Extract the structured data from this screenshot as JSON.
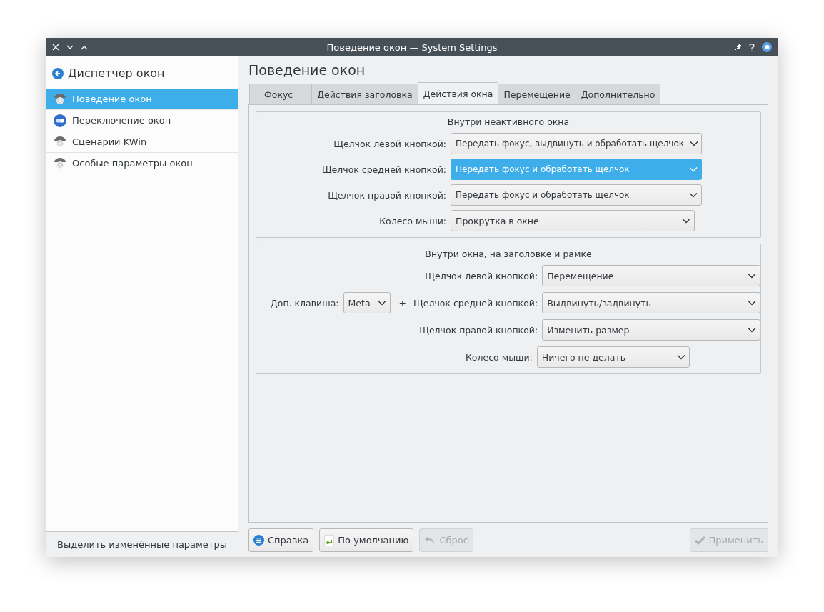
{
  "window": {
    "title": "Поведение окон — System Settings"
  },
  "sidebar": {
    "title": "Диспетчер окон",
    "items": [
      {
        "label": "Поведение окон",
        "selected": true,
        "kind": "gear"
      },
      {
        "label": "Переключение окон",
        "selected": false,
        "kind": "switch"
      },
      {
        "label": "Сценарии KWin",
        "selected": false,
        "kind": "gear"
      },
      {
        "label": "Особые параметры окон",
        "selected": false,
        "kind": "gear"
      }
    ],
    "footer": "Выделить изменённые параметры"
  },
  "page_title": "Поведение окон",
  "tabs": [
    {
      "label": "Фокус",
      "selected": false
    },
    {
      "label": "Действия заголовка",
      "selected": false
    },
    {
      "label": "Действия окна",
      "selected": true
    },
    {
      "label": "Перемещение",
      "selected": false
    },
    {
      "label": "Дополнительно",
      "selected": false
    }
  ],
  "inactive_group": {
    "title": "Внутри неактивного окна",
    "rows": [
      {
        "label": "Щелчок левой кнопкой:",
        "value": "Передать фокус, выдвинуть и обработать щелчок",
        "focused": false
      },
      {
        "label": "Щелчок средней кнопкой:",
        "value": "Передать фокус и обработать щелчок",
        "focused": true
      },
      {
        "label": "Щелчок правой кнопкой:",
        "value": "Передать фокус и обработать щелчок",
        "focused": false
      },
      {
        "label": "Колесо мыши:",
        "value": "Прокрутка в окне",
        "focused": false
      }
    ]
  },
  "active_group": {
    "title": "Внутри окна, на заголовке и рамке",
    "modifier_label": "Доп. клавиша:",
    "modifier_value": "Meta",
    "plus": "+",
    "rows": [
      {
        "label": "Щелчок левой кнопкой:",
        "value": "Перемещение",
        "focused": false
      },
      {
        "label": "Щелчок средней кнопкой:",
        "value": "Выдвинуть/задвинуть",
        "focused": false
      },
      {
        "label": "Щелчок правой кнопкой:",
        "value": "Изменить размер",
        "focused": false
      }
    ],
    "wheel": {
      "label": "Колесо мыши:",
      "value": "Ничего не делать",
      "focused": false
    }
  },
  "buttons": [
    {
      "label": "Справка",
      "kind": "help",
      "disabled": false
    },
    {
      "label": "По умолчанию",
      "kind": "defaults",
      "disabled": false
    },
    {
      "label": "Сброс",
      "kind": "reset",
      "disabled": true
    }
  ],
  "apply_button": {
    "label": "Применить",
    "disabled": true
  }
}
